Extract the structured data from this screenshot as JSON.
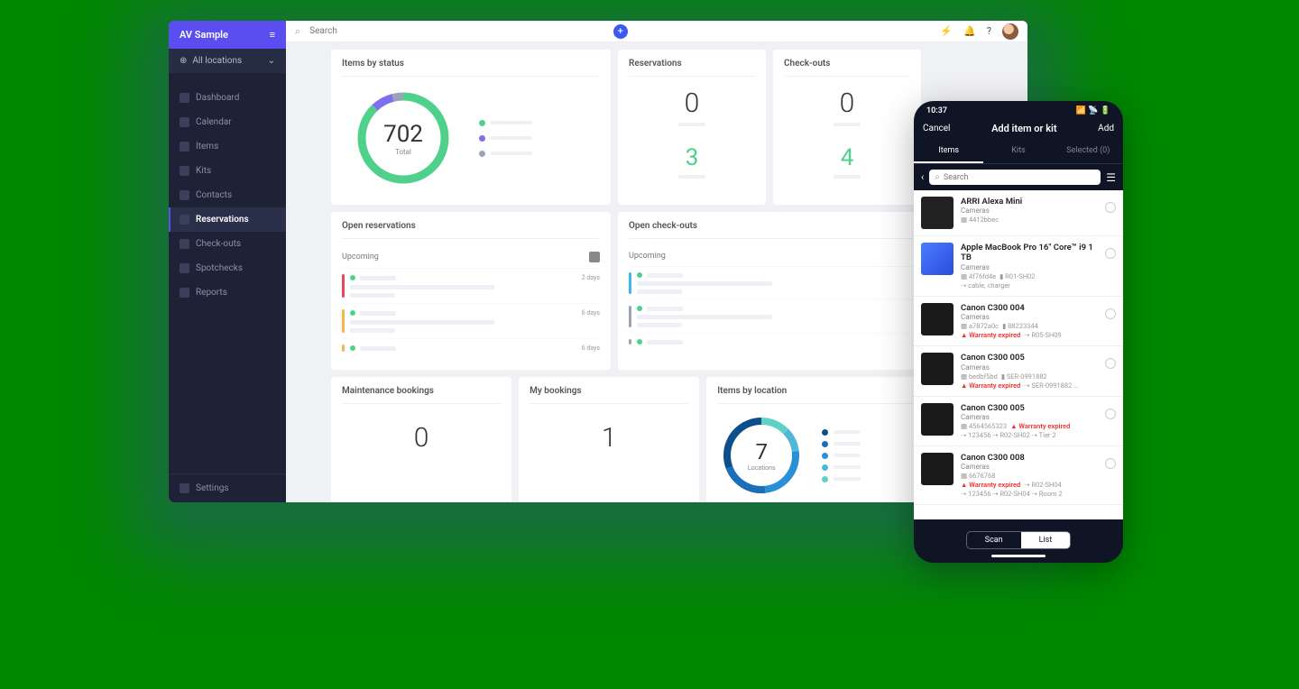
{
  "sidebar": {
    "app_name": "AV Sample",
    "location_label": "All locations",
    "items": [
      {
        "label": "Dashboard"
      },
      {
        "label": "Calendar"
      },
      {
        "label": "Items"
      },
      {
        "label": "Kits"
      },
      {
        "label": "Contacts"
      },
      {
        "label": "Reservations"
      },
      {
        "label": "Check-outs"
      },
      {
        "label": "Spotchecks"
      },
      {
        "label": "Reports"
      }
    ],
    "settings_label": "Settings"
  },
  "topbar": {
    "search_placeholder": "Search"
  },
  "cards": {
    "status": {
      "title": "Items by status",
      "total_value": "702",
      "total_label": "Total"
    },
    "reservations": {
      "title": "Reservations",
      "top": "0",
      "bottom": "3"
    },
    "checkouts": {
      "title": "Check-outs",
      "top": "0",
      "bottom": "4"
    },
    "open_res": {
      "title": "Open reservations",
      "sub": "Upcoming",
      "d1": "2 days",
      "d2": "6 days",
      "d3": "6 days"
    },
    "open_co": {
      "title": "Open check-outs",
      "sub": "Upcoming"
    },
    "maint": {
      "title": "Maintenance bookings",
      "value": "0"
    },
    "book": {
      "title": "My bookings",
      "value": "1"
    },
    "loc": {
      "title": "Items by location",
      "value": "7",
      "label": "Locations"
    }
  },
  "mobile": {
    "time": "10:37",
    "cancel": "Cancel",
    "title": "Add item or kit",
    "add": "Add",
    "tabs": {
      "items": "Items",
      "kits": "Kits",
      "selected": "Selected (0)"
    },
    "search_placeholder": "Search",
    "toggle": {
      "scan": "Scan",
      "list": "List"
    },
    "items": [
      {
        "name": "ARRI Alexa Mini",
        "cat": "Cameras",
        "meta1": "4412bbec"
      },
      {
        "name": "Apple MacBook Pro 16\" Core™ i9 1 TB",
        "cat": "Cameras",
        "meta1": "4f76fd4e",
        "meta2": "R01-SH02",
        "meta3": "cable, charger"
      },
      {
        "name": "Canon C300 004",
        "cat": "Cameras",
        "meta1": "a7872a0c",
        "meta2": "88223344",
        "warn": "Warranty expired",
        "meta3": "R05-SH09"
      },
      {
        "name": "Canon C300 005",
        "cat": "Cameras",
        "meta1": "bedbf5bd",
        "meta2": "SER-0991882",
        "warn": "Warranty expired",
        "meta3": "SER-0991882 …"
      },
      {
        "name": "Canon C300 005",
        "cat": "Cameras",
        "meta1": "4564565323",
        "warn": "Warranty expired",
        "meta2": "123456",
        "meta3": "R02-SH02",
        "meta4": "Tier 2"
      },
      {
        "name": "Canon C300 008",
        "cat": "Cameras",
        "meta1": "6676768",
        "warn": "Warranty expired",
        "meta2": "123456",
        "meta3": "R02-SH04",
        "meta4": "Room 2"
      }
    ]
  },
  "chart_data": [
    {
      "type": "pie",
      "title": "Items by status",
      "total": 702,
      "series": [
        {
          "name": "status-green",
          "value_pct": 88,
          "color": "#4fd18b"
        },
        {
          "name": "status-purple",
          "value_pct": 8,
          "color": "#7e6ef0"
        },
        {
          "name": "status-grey",
          "value_pct": 4,
          "color": "#9aa3b8"
        }
      ]
    },
    {
      "type": "pie",
      "title": "Items by location",
      "total": 7,
      "series": [
        {
          "name": "loc-1",
          "color": "#0d4f8b"
        },
        {
          "name": "loc-2",
          "color": "#1a6fb8"
        },
        {
          "name": "loc-3",
          "color": "#2a8fd8"
        },
        {
          "name": "loc-4",
          "color": "#4fb8d8"
        },
        {
          "name": "loc-5",
          "color": "#5fd1c8"
        },
        {
          "name": "loc-6",
          "color": "#1a4a6b"
        },
        {
          "name": "loc-7",
          "color": "#0a2a4b"
        }
      ]
    }
  ]
}
